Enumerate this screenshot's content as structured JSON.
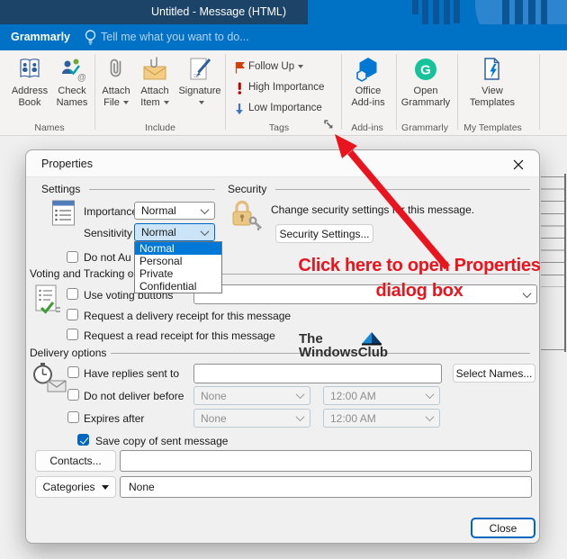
{
  "window": {
    "title": "Untitled - Message (HTML)"
  },
  "tabbar": {
    "tab": "Grammarly",
    "tellme": "Tell me what you want to do..."
  },
  "ribbon": {
    "groups": {
      "names": {
        "label": "Names",
        "address_book": [
          "Address",
          "Book"
        ],
        "check_names": [
          "Check",
          "Names"
        ]
      },
      "include": {
        "label": "Include",
        "attach_file": [
          "Attach",
          "File"
        ],
        "attach_item": [
          "Attach",
          "Item"
        ],
        "signature": "Signature"
      },
      "tags": {
        "label": "Tags",
        "follow_up": "Follow Up",
        "high_importance": "High Importance",
        "low_importance": "Low Importance"
      },
      "addins": {
        "label": "Add-ins",
        "office_addins": [
          "Office",
          "Add-ins"
        ]
      },
      "grammarly": {
        "label": "Grammarly",
        "open_grammarly": [
          "Open",
          "Grammarly"
        ]
      },
      "templates": {
        "label": "My Templates",
        "view_templates": [
          "View",
          "Templates"
        ]
      }
    }
  },
  "dialog": {
    "title": "Properties",
    "settings": {
      "header": "Settings",
      "importance_label": "Importance",
      "importance_value": "Normal",
      "sensitivity_label": "Sensitivity",
      "sensitivity_value": "Normal",
      "options": [
        "Normal",
        "Personal",
        "Private",
        "Confidential"
      ]
    },
    "security": {
      "header": "Security",
      "text": "Change security settings for this message.",
      "button": "Security Settings..."
    },
    "autoarchive_label": "Do not Au",
    "voting": {
      "header": "Voting and Tracking op",
      "use_voting": "Use voting buttons",
      "delivery_receipt": "Request a delivery receipt for this message",
      "read_receipt": "Request a read receipt for this message"
    },
    "delivery": {
      "header": "Delivery options",
      "have_replies": "Have replies sent to",
      "select_names": "Select Names...",
      "no_deliver": "Do not deliver before",
      "expires": "Expires after",
      "none": "None",
      "time": "12:00 AM",
      "save_copy": "Save copy of sent message"
    },
    "footer": {
      "contacts": "Contacts...",
      "categories": "Categories",
      "categories_value": "None",
      "close": "Close"
    }
  },
  "annotation": {
    "line1": "Click here to open Properties",
    "line2": "dialog box"
  },
  "watermark": {
    "line1": "The",
    "line2": "WindowsClub"
  },
  "colors": {
    "titlebar_blue": "#0072c6",
    "titlebar_navy": "#1c4468",
    "selection_blue": "#0078d7",
    "focus_combo": "#cce4f7",
    "annotation_red": "#e9141d",
    "grammarly_green": "#15c39a",
    "addin_blue": "#0078d4"
  }
}
